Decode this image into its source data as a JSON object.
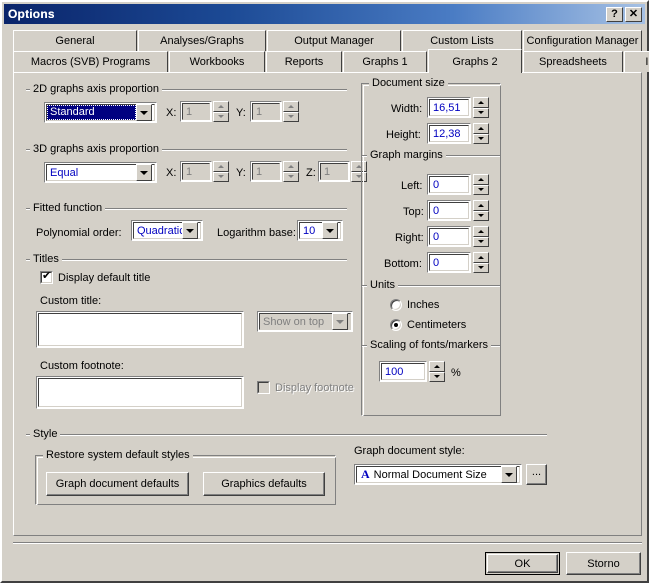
{
  "window": {
    "title": "Options",
    "help_button": "?",
    "close_button": "✕"
  },
  "tabs": {
    "row1": [
      {
        "label": "General",
        "selected": false
      },
      {
        "label": "Analyses/Graphs",
        "selected": false
      },
      {
        "label": "Output Manager",
        "selected": false
      },
      {
        "label": "Custom Lists",
        "selected": false
      },
      {
        "label": "Configuration Manager",
        "selected": false
      }
    ],
    "row2": [
      {
        "label": "Macros (SVB) Programs",
        "selected": false
      },
      {
        "label": "Workbooks",
        "selected": false
      },
      {
        "label": "Reports",
        "selected": false
      },
      {
        "label": "Graphs 1",
        "selected": false
      },
      {
        "label": "Graphs 2",
        "selected": true
      },
      {
        "label": "Spreadsheets",
        "selected": false
      },
      {
        "label": "Import",
        "selected": false
      }
    ]
  },
  "axis_2d": {
    "group_title": "2D graphs axis proportion",
    "proportion_value": "Standard",
    "x_label": "X:",
    "x_value": "1",
    "y_label": "Y:",
    "y_value": "1"
  },
  "axis_3d": {
    "group_title": "3D graphs axis proportion",
    "proportion_value": "Equal",
    "x_label": "X:",
    "x_value": "1",
    "y_label": "Y:",
    "y_value": "1",
    "z_label": "Z:",
    "z_value": "1"
  },
  "fitted_function": {
    "group_title": "Fitted function",
    "polynomial_label": "Polynomial order:",
    "polynomial_value": "Quadratic",
    "logarithm_label": "Logarithm base:",
    "logarithm_value": "10"
  },
  "titles": {
    "group_title": "Titles",
    "display_default_title_label": "Display default title",
    "display_default_title_checked": true,
    "custom_title_label": "Custom title:",
    "custom_title_value": "",
    "show_on_top_value": "Show on top",
    "custom_footnote_label": "Custom footnote:",
    "custom_footnote_value": "",
    "display_footnote_label": "Display footnote",
    "display_footnote_checked": false
  },
  "document_size": {
    "group_title": "Document size",
    "width_label": "Width:",
    "width_value": "16,51",
    "height_label": "Height:",
    "height_value": "12,38"
  },
  "graph_margins": {
    "group_title": "Graph margins",
    "left_label": "Left:",
    "left_value": "0",
    "top_label": "Top:",
    "top_value": "0",
    "right_label": "Right:",
    "right_value": "0",
    "bottom_label": "Bottom:",
    "bottom_value": "0"
  },
  "units": {
    "group_title": "Units",
    "inches_label": "Inches",
    "centimeters_label": "Centimeters",
    "selected": "Centimeters"
  },
  "scaling": {
    "group_title": "Scaling of fonts/markers",
    "value": "100",
    "percent_sign": "%"
  },
  "style": {
    "group_title": "Style",
    "restore_group_title": "Restore system default styles",
    "graph_document_defaults_label": "Graph document defaults",
    "graphics_defaults_label": "Graphics defaults",
    "graph_document_style_label": "Graph document style:",
    "graph_document_style_value": "Normal Document Size",
    "graph_document_style_icon": "A",
    "browse_label": "..."
  },
  "footer": {
    "ok_label": "OK",
    "cancel_label": "Storno"
  },
  "colors": {
    "face": "#d4d0c8",
    "highlight": "#000080",
    "field_text": "#0000c0",
    "disabled_text": "#808080",
    "title_start": "#0a246a",
    "title_end": "#a6c1e4"
  }
}
